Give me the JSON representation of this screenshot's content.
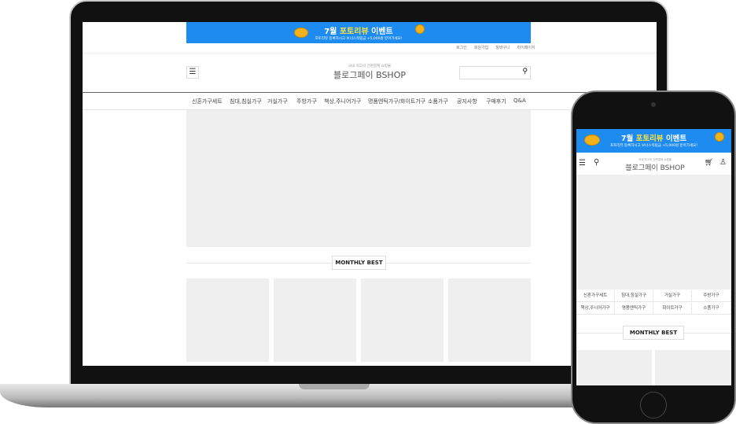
{
  "banner": {
    "title_prefix": "7월 ",
    "title_highlight": "포토리뷰",
    "title_suffix": " 이벤트",
    "subtitle": "포토리뷰 등록하시고 보너스적립금 +5,000원 받아가세요!"
  },
  "top_links": [
    "로그인",
    "회원가입",
    "장바구니",
    "마이페이지"
  ],
  "logo": {
    "tagline": "국내 최고의 간편결제 쇼핑몰",
    "name": "블로그페이 BSHOP"
  },
  "nav": [
    "신혼가구세트",
    "침대,침실가구",
    "거실가구",
    "주방가구",
    "책상,주니어가구",
    "명품엔틱가구/화이트가구",
    "소품가구",
    "공지사항",
    "구매후기",
    "Q&A"
  ],
  "mobile_categories": [
    "신혼가구세트",
    "침대,침실가구",
    "거실가구",
    "주방가구",
    "책상,주니어가구",
    "명품엔틱가구",
    "화이트가구",
    "소품가구"
  ],
  "section_title": "MONTHLY BEST",
  "colors": {
    "banner": "#1e8bf0",
    "highlight": "#ffe23a"
  }
}
